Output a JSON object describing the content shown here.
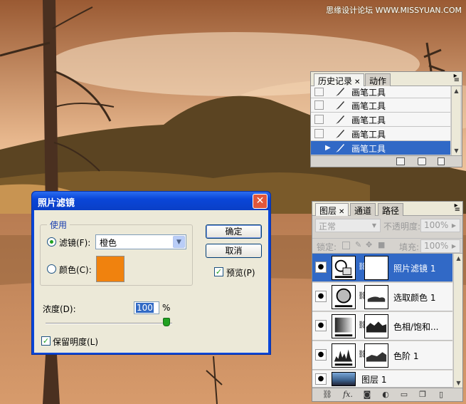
{
  "watermark": "思缘设计论坛  WWW.MISSYUAN.COM",
  "history_panel": {
    "tabs": [
      {
        "label": "历史记录"
      },
      {
        "label": "动作"
      }
    ],
    "rows": [
      {
        "label": "画笔工具"
      },
      {
        "label": "画笔工具"
      },
      {
        "label": "画笔工具"
      },
      {
        "label": "画笔工具"
      },
      {
        "label": "画笔工具",
        "selected": true
      }
    ]
  },
  "photo_filter_dialog": {
    "title": "照片滤镜",
    "close_label": "✕",
    "group_label": "使用",
    "filter_radio_label": "滤镜(F):",
    "filter_value": "橙色",
    "color_radio_label": "颜色(C):",
    "color_swatch": "#f0820e",
    "ok_label": "确定",
    "cancel_label": "取消",
    "preview_label": "预览(P)",
    "density_label": "浓度(D):",
    "density_value": "100",
    "density_unit": "%",
    "density_level": 100,
    "preserve_luminosity_label": "保留明度(L)"
  },
  "layers_panel": {
    "tabs": [
      {
        "label": "图层"
      },
      {
        "label": "通道"
      },
      {
        "label": "路径"
      }
    ],
    "blend_mode": "正常",
    "opacity_label": "不透明度:",
    "opacity_value": "100%",
    "lock_label": "锁定:",
    "fill_label": "填充:",
    "fill_value": "100%",
    "layers": [
      {
        "name": "照片滤镜 1",
        "selected": true
      },
      {
        "name": "选取颜色 1"
      },
      {
        "name": "色相/饱和..."
      },
      {
        "name": "色阶 1"
      },
      {
        "name": "图层 1"
      }
    ],
    "footer": {
      "link": "⛓",
      "fx": "fx."
    }
  },
  "colors": {
    "accent_blue": "#3169c6",
    "xp_title_blue": "#0a46d8",
    "orange": "#f0820e"
  }
}
